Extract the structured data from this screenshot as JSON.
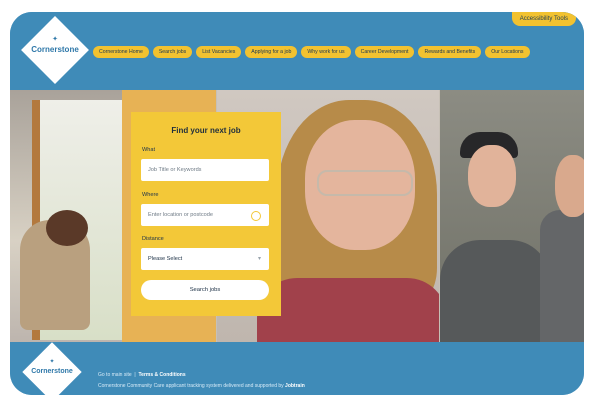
{
  "brand": {
    "name": "Cornerstone",
    "footer_name": "Cornerstone"
  },
  "top": {
    "accessibility": "Accessibility Tools"
  },
  "nav": [
    "Cornerstone Home",
    "Search jobs",
    "List Vacancies",
    "Applying for a job",
    "Why work for us",
    "Career Development",
    "Rewards and Benefits",
    "Our Locations"
  ],
  "search": {
    "title": "Find your next job",
    "what_label": "What",
    "what_placeholder": "Job Title or Keywords",
    "where_label": "Where",
    "where_placeholder": "Enter location or postcode",
    "distance_label": "Distance",
    "distance_value": "Please Select",
    "button": "Search jobs"
  },
  "footer": {
    "skip": "Go to main site",
    "terms": "Terms & Conditions",
    "line2": "Cornerstone Community Care applicant tracking system delivered and supported by",
    "partner": "Jobtrain"
  }
}
